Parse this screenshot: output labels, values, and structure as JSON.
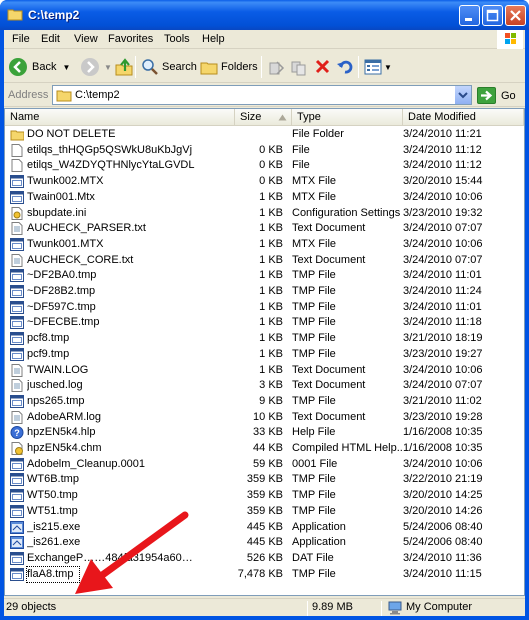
{
  "window": {
    "title": "C:\\temp2",
    "buttons": [
      "minimize",
      "maximize",
      "close"
    ]
  },
  "menu": [
    "File",
    "Edit",
    "View",
    "Favorites",
    "Tools",
    "Help"
  ],
  "toolbar": {
    "back_label": "Back",
    "search_label": "Search",
    "folders_label": "Folders"
  },
  "address": {
    "label": "Address",
    "value": "C:\\temp2",
    "go_label": "Go"
  },
  "columns": [
    "Name",
    "Size",
    "Type",
    "Date Modified"
  ],
  "files": [
    {
      "name": "DO NOT DELETE",
      "size": "",
      "type": "File Folder",
      "date": "3/24/2010 11:21",
      "icon": "folder-icon"
    },
    {
      "name": "etilqs_thHQGp5QSWkU8uKbJgVj",
      "size": "0 KB",
      "type": "File",
      "date": "3/24/2010 11:12",
      "icon": "generic-file-icon"
    },
    {
      "name": "etilqs_W4ZDYQTHNlycYtaLGVDL",
      "size": "0 KB",
      "type": "File",
      "date": "3/24/2010 11:12",
      "icon": "generic-file-icon"
    },
    {
      "name": "Twunk002.MTX",
      "size": "0 KB",
      "type": "MTX File",
      "date": "3/20/2010 15:44",
      "icon": "window-file-icon"
    },
    {
      "name": "Twain001.Mtx",
      "size": "1 KB",
      "type": "MTX File",
      "date": "3/24/2010 10:06",
      "icon": "window-file-icon"
    },
    {
      "name": "sbupdate.ini",
      "size": "1 KB",
      "type": "Configuration Settings",
      "date": "3/23/2010 19:32",
      "icon": "settings-file-icon"
    },
    {
      "name": "AUCHECK_PARSER.txt",
      "size": "1 KB",
      "type": "Text Document",
      "date": "3/24/2010 07:07",
      "icon": "text-file-icon"
    },
    {
      "name": "Twunk001.MTX",
      "size": "1 KB",
      "type": "MTX File",
      "date": "3/24/2010 10:06",
      "icon": "window-file-icon"
    },
    {
      "name": "AUCHECK_CORE.txt",
      "size": "1 KB",
      "type": "Text Document",
      "date": "3/24/2010 07:07",
      "icon": "text-file-icon"
    },
    {
      "name": "~DF2BA0.tmp",
      "size": "1 KB",
      "type": "TMP File",
      "date": "3/24/2010 11:01",
      "icon": "window-file-icon"
    },
    {
      "name": "~DF28B2.tmp",
      "size": "1 KB",
      "type": "TMP File",
      "date": "3/24/2010 11:24",
      "icon": "window-file-icon"
    },
    {
      "name": "~DF597C.tmp",
      "size": "1 KB",
      "type": "TMP File",
      "date": "3/24/2010 11:01",
      "icon": "window-file-icon"
    },
    {
      "name": "~DFECBE.tmp",
      "size": "1 KB",
      "type": "TMP File",
      "date": "3/24/2010 11:18",
      "icon": "window-file-icon"
    },
    {
      "name": "pcf8.tmp",
      "size": "1 KB",
      "type": "TMP File",
      "date": "3/21/2010 18:19",
      "icon": "window-file-icon"
    },
    {
      "name": "pcf9.tmp",
      "size": "1 KB",
      "type": "TMP File",
      "date": "3/23/2010 19:27",
      "icon": "window-file-icon"
    },
    {
      "name": "TWAIN.LOG",
      "size": "1 KB",
      "type": "Text Document",
      "date": "3/24/2010 10:06",
      "icon": "text-file-icon"
    },
    {
      "name": "jusched.log",
      "size": "3 KB",
      "type": "Text Document",
      "date": "3/24/2010 07:07",
      "icon": "text-file-icon"
    },
    {
      "name": "nps265.tmp",
      "size": "9 KB",
      "type": "TMP File",
      "date": "3/21/2010 11:02",
      "icon": "window-file-icon"
    },
    {
      "name": "AdobeARM.log",
      "size": "10 KB",
      "type": "Text Document",
      "date": "3/23/2010 19:28",
      "icon": "text-file-icon"
    },
    {
      "name": "hpzEN5k4.hlp",
      "size": "33 KB",
      "type": "Help File",
      "date": "1/16/2008 10:35",
      "icon": "help-file-icon"
    },
    {
      "name": "hpzEN5k4.chm",
      "size": "44 KB",
      "type": "Compiled HTML Help...",
      "date": "1/16/2008 10:35",
      "icon": "chm-file-icon"
    },
    {
      "name": "Adobelm_Cleanup.0001",
      "size": "59 KB",
      "type": "0001 File",
      "date": "3/24/2010 10:06",
      "icon": "window-file-icon"
    },
    {
      "name": "WT6B.tmp",
      "size": "359 KB",
      "type": "TMP File",
      "date": "3/22/2010 21:19",
      "icon": "window-file-icon"
    },
    {
      "name": "WT50.tmp",
      "size": "359 KB",
      "type": "TMP File",
      "date": "3/20/2010 14:25",
      "icon": "window-file-icon"
    },
    {
      "name": "WT51.tmp",
      "size": "359 KB",
      "type": "TMP File",
      "date": "3/20/2010 14:26",
      "icon": "window-file-icon"
    },
    {
      "name": "_is215.exe",
      "size": "445 KB",
      "type": "Application",
      "date": "5/24/2006 08:40",
      "icon": "exe-file-icon"
    },
    {
      "name": "_is261.exe",
      "size": "445 KB",
      "type": "Application",
      "date": "5/24/2006 08:40",
      "icon": "exe-file-icon"
    },
    {
      "name": "ExchangeP……484fa31954a60…",
      "size": "526 KB",
      "type": "DAT File",
      "date": "3/24/2010 11:36",
      "icon": "window-file-icon"
    },
    {
      "name": "flaA8.tmp",
      "size": "7,478 KB",
      "type": "TMP File",
      "date": "3/24/2010 11:15",
      "icon": "window-file-icon"
    }
  ],
  "status": {
    "objects": "29 objects",
    "size": "9.89 MB",
    "location": "My Computer"
  },
  "colors": {
    "titlebar": "#0a5ce6",
    "arrow": "#e8161b",
    "window_bg": "#ece9d8"
  }
}
